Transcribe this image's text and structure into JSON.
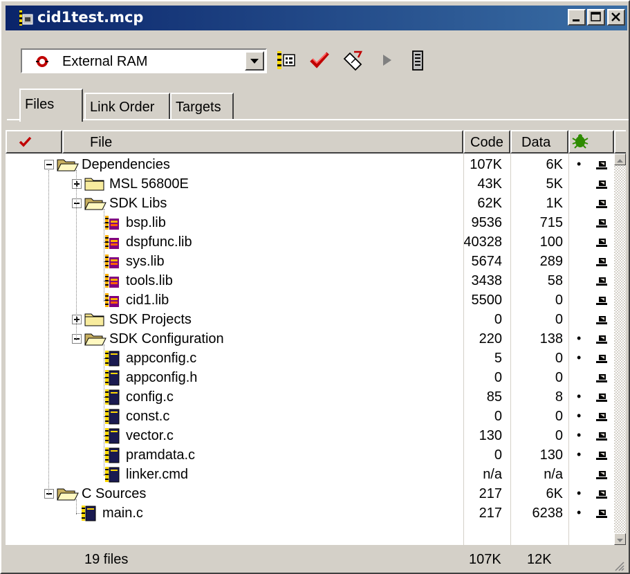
{
  "window": {
    "title": "cid1test.mcp",
    "controls": [
      "minimize-icon",
      "maximize-icon",
      "close-icon"
    ]
  },
  "toolbar": {
    "target_select": "External RAM",
    "tools": [
      "settings-icon",
      "check-syntax-icon",
      "make-icon",
      "run-icon",
      "debug-icon"
    ]
  },
  "tabs": [
    {
      "label": "Files",
      "active": true
    },
    {
      "label": "Link Order",
      "active": false
    },
    {
      "label": "Targets",
      "active": false
    }
  ],
  "columns": {
    "check": "",
    "file": "File",
    "code": "Code",
    "data": "Data"
  },
  "rows": [
    {
      "name": "Dependencies",
      "code": "107K",
      "data": "6K",
      "dot": true,
      "type": "folder-open",
      "level": 0,
      "expander": "minus"
    },
    {
      "name": "MSL 56800E",
      "code": "43K",
      "data": "5K",
      "dot": false,
      "type": "folder",
      "level": 1,
      "expander": "plus"
    },
    {
      "name": "SDK Libs",
      "code": "62K",
      "data": "1K",
      "dot": false,
      "type": "folder-open",
      "level": 1,
      "expander": "minus"
    },
    {
      "name": "bsp.lib",
      "code": "9536",
      "data": "715",
      "dot": false,
      "type": "lib",
      "level": 2
    },
    {
      "name": "dspfunc.lib",
      "code": "40328",
      "data": "100",
      "dot": false,
      "type": "lib",
      "level": 2
    },
    {
      "name": "sys.lib",
      "code": "5674",
      "data": "289",
      "dot": false,
      "type": "lib",
      "level": 2
    },
    {
      "name": "tools.lib",
      "code": "3438",
      "data": "58",
      "dot": false,
      "type": "lib",
      "level": 2
    },
    {
      "name": "cid1.lib",
      "code": "5500",
      "data": "0",
      "dot": false,
      "type": "lib",
      "level": 2
    },
    {
      "name": "SDK Projects",
      "code": "0",
      "data": "0",
      "dot": false,
      "type": "folder",
      "level": 1,
      "expander": "plus"
    },
    {
      "name": "SDK Configuration",
      "code": "220",
      "data": "138",
      "dot": true,
      "type": "folder-open",
      "level": 1,
      "expander": "minus"
    },
    {
      "name": "appconfig.c",
      "code": "5",
      "data": "0",
      "dot": true,
      "type": "src",
      "level": 2
    },
    {
      "name": "appconfig.h",
      "code": "0",
      "data": "0",
      "dot": false,
      "type": "src",
      "level": 2
    },
    {
      "name": "config.c",
      "code": "85",
      "data": "8",
      "dot": true,
      "type": "src",
      "level": 2
    },
    {
      "name": "const.c",
      "code": "0",
      "data": "0",
      "dot": true,
      "type": "src",
      "level": 2
    },
    {
      "name": "vector.c",
      "code": "130",
      "data": "0",
      "dot": true,
      "type": "src",
      "level": 2
    },
    {
      "name": "pramdata.c",
      "code": "0",
      "data": "130",
      "dot": true,
      "type": "src",
      "level": 2
    },
    {
      "name": "linker.cmd",
      "code": "n/a",
      "data": "n/a",
      "dot": false,
      "type": "src",
      "level": 2
    },
    {
      "name": "C Sources",
      "code": "217",
      "data": "6K",
      "dot": true,
      "type": "folder-open",
      "level": 0,
      "expander": "minus"
    },
    {
      "name": "main.c",
      "code": "217",
      "data": "6238",
      "dot": true,
      "type": "src",
      "level": 1
    }
  ],
  "status": {
    "files": "19 files",
    "code_total": "107K",
    "data_total": "12K"
  },
  "colors": {
    "title_start": "#0a246a",
    "title_end": "#3a6ea5",
    "face": "#d4d0c8",
    "check_red": "#c00000",
    "bug_green": "#2e8b00"
  }
}
